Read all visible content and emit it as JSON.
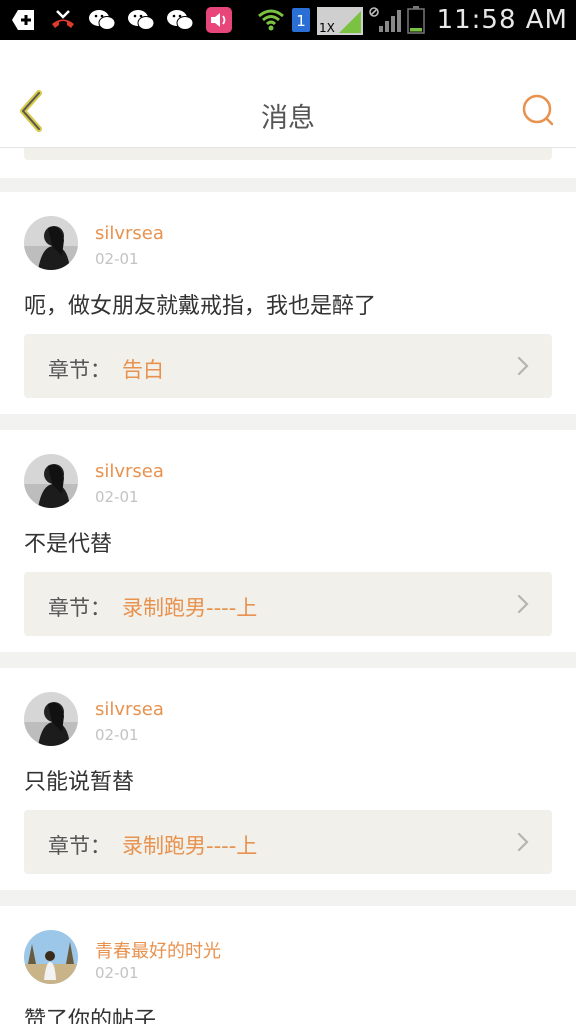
{
  "status_bar": {
    "time": "11:58 AM",
    "icons": [
      "add-icon",
      "missed-call-icon",
      "wechat-icon",
      "wechat-icon",
      "wechat-icon",
      "volume-app-icon",
      "wifi-icon",
      "sim-1-icon",
      "network-1x-icon",
      "signal-icon",
      "battery-icon"
    ],
    "sim_label": "1",
    "network_label": "1X"
  },
  "nav": {
    "title": "消息",
    "accent_color": "#e8924f",
    "back_icon": "chevron-left-icon",
    "search_icon": "search-icon"
  },
  "messages": [
    {
      "user": "silvrsea",
      "date": "02-01",
      "text": "呃，做女朋友就戴戒指，我也是醉了",
      "chapter_label": "章节：",
      "chapter": "告白"
    },
    {
      "user": "silvrsea",
      "date": "02-01",
      "text": "不是代替",
      "chapter_label": "章节：",
      "chapter": "录制跑男----上"
    },
    {
      "user": "silvrsea",
      "date": "02-01",
      "text": "只能说暂替",
      "chapter_label": "章节：",
      "chapter": "录制跑男----上"
    },
    {
      "user": "青春最好的时光",
      "date": "02-01",
      "text": "赞了你的帖子"
    }
  ]
}
